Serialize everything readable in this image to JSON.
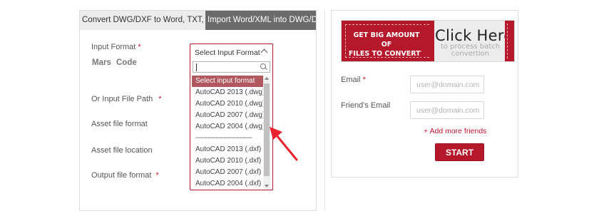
{
  "tabs": [
    {
      "label": "Convert DWG/DXF to Word, TXT, XML",
      "active": false
    },
    {
      "label": "Import Word/XML into DWG/DXF",
      "active": true
    }
  ],
  "form": {
    "input_format_label": "Input Format",
    "required_mark": "*",
    "mars_label": "Mars",
    "code_label": "Code",
    "input_file_path_label": "Or Input File Path",
    "asset_file_format_label": "Asset file format",
    "asset_file_location_label": "Asset file location",
    "output_file_format_label": "Output file format"
  },
  "select": {
    "value": "Select Input Format",
    "search_value": "",
    "options": [
      {
        "label": "Select input format",
        "selected": true
      },
      {
        "label": "AutoCAD 2013 (.dwg)"
      },
      {
        "label": "AutoCAD 2010 (.dwg)"
      },
      {
        "label": "AutoCAD 2007 (.dwg)"
      },
      {
        "label": "AutoCAD 2004 (.dwg)"
      },
      {
        "label": "----------------------------",
        "separator": true
      },
      {
        "label": "AutoCAD 2013 (.dxf)"
      },
      {
        "label": "AutoCAD 2010 (.dxf)"
      },
      {
        "label": "AutoCAD 2007 (.dxf)"
      },
      {
        "label": "AutoCAD 2004 (.dxf)"
      }
    ]
  },
  "banner": {
    "promo_line1": "GET BIG AMOUNT OF",
    "promo_line2": "FILES TO CONVERT?",
    "cta": "Click Here",
    "sub_line1": "to process batch",
    "sub_line2": "convertion"
  },
  "sidebar_form": {
    "email_label": "Email",
    "email_placeholder": "user@domain.com",
    "friend_email_label": "Friend's Email",
    "friend_email_placeholder": "user@domain.com",
    "add_more": "+ Add more friends",
    "start": "START"
  },
  "colors": {
    "accent": "#b5172b",
    "selected_option": "#b0575f",
    "active_tab": "#6b6b6b",
    "annotation_arrow": "#e8232f"
  },
  "icons": [
    "search-icon",
    "chevron-up-icon",
    "annotation-arrow-icon"
  ]
}
